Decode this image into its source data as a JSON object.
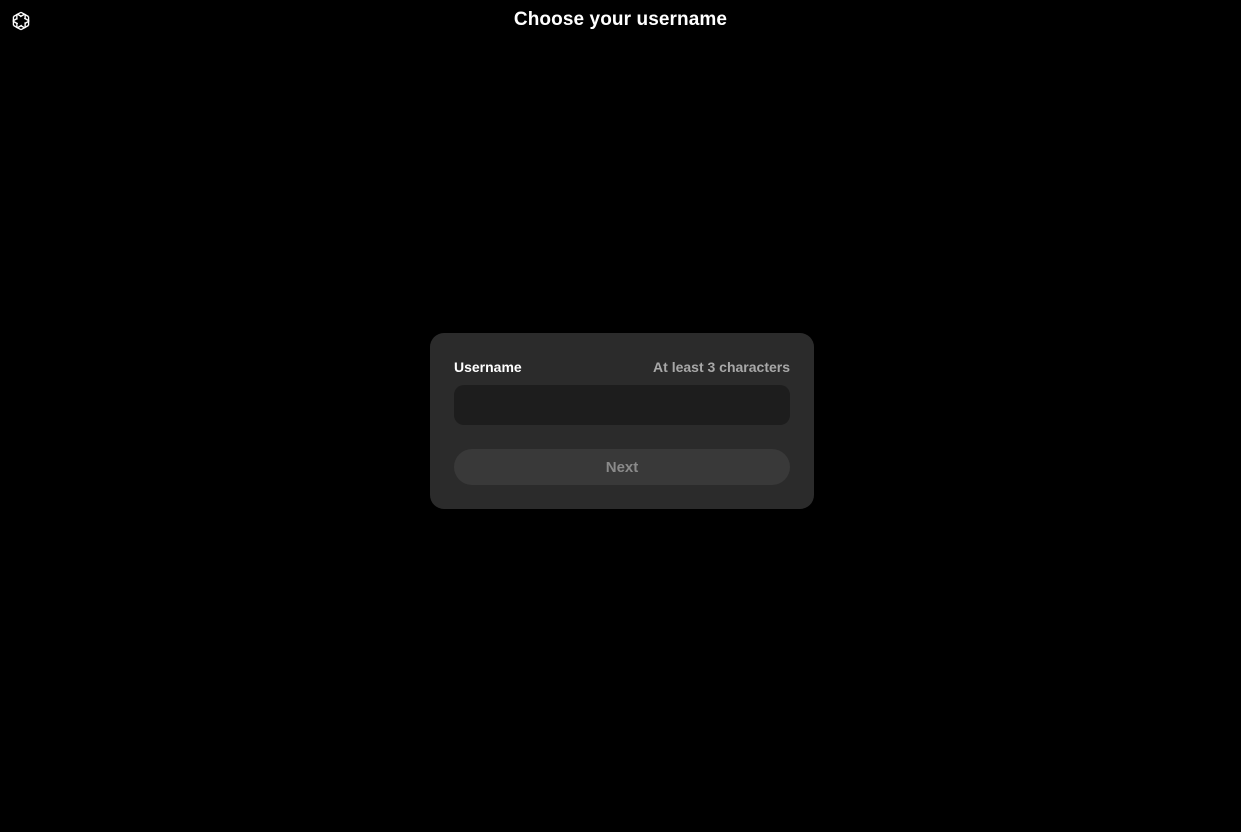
{
  "header": {
    "logo_icon": "openai-logo-icon",
    "title": "Choose your username"
  },
  "form": {
    "username_label": "Username",
    "username_hint": "At least 3 characters",
    "username_value": "",
    "username_placeholder": "",
    "next_label": "Next",
    "next_enabled": false
  },
  "colors": {
    "background": "#000000",
    "card": "#2b2b2b",
    "input": "#1d1d1d",
    "button_disabled": "#393939",
    "text_primary": "#ffffff",
    "text_muted": "#a8a8a8"
  }
}
